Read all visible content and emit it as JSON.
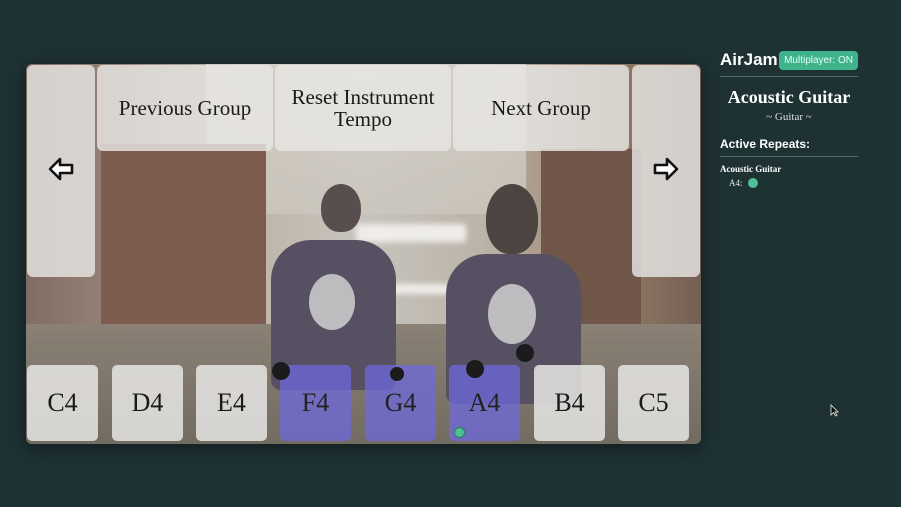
{
  "controls": {
    "previous_group": "Previous Group",
    "reset_tempo": "Reset Instrument Tempo",
    "next_group": "Next Group"
  },
  "notes": [
    {
      "label": "C4",
      "active": false
    },
    {
      "label": "D4",
      "active": false
    },
    {
      "label": "E4",
      "active": false
    },
    {
      "label": "F4",
      "active": true
    },
    {
      "label": "G4",
      "active": true
    },
    {
      "label": "A4",
      "active": true
    },
    {
      "label": "B4",
      "active": false
    },
    {
      "label": "C5",
      "active": false
    }
  ],
  "panel": {
    "brand": "AirJam",
    "multiplayer_badge": "Multiplayer: ON",
    "instrument_name": "Acoustic Guitar",
    "instrument_family": "~ Guitar ~",
    "active_repeats_title": "Active Repeats:",
    "repeats": [
      {
        "instrument": "Acoustic Guitar",
        "note": "A4:"
      }
    ]
  },
  "colors": {
    "background": "#1e3234",
    "accent": "#3fb38b",
    "active_note": "#6e69e1"
  },
  "icons": {
    "left": "arrow-left-icon",
    "right": "arrow-right-icon"
  }
}
